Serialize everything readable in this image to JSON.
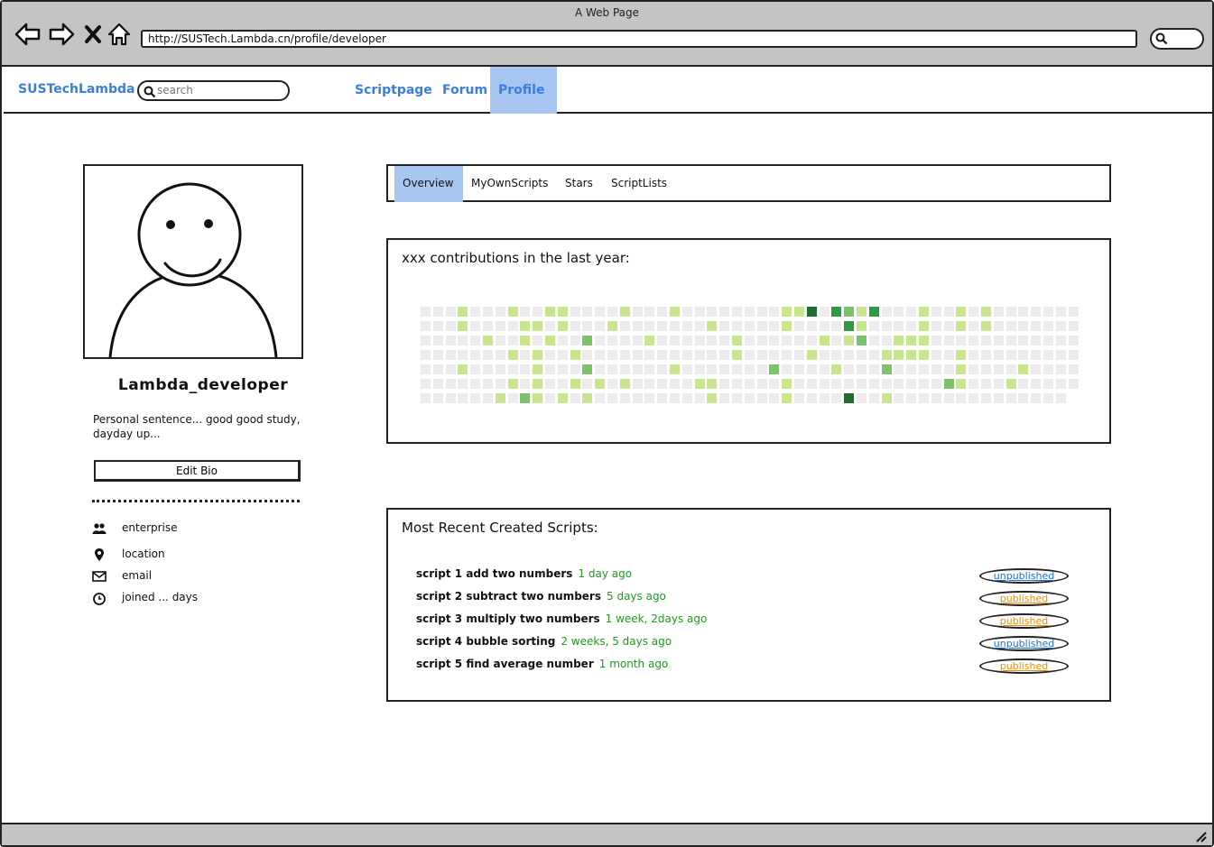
{
  "browser": {
    "window_title": "A Web Page",
    "url": "http://SUSTech.Lambda.cn/profile/developer",
    "icons": [
      "back-arrow-icon",
      "forward-arrow-icon",
      "close-x-icon",
      "home-icon",
      "search-icon"
    ]
  },
  "appbar": {
    "brand": "SUSTechLambda",
    "search_placeholder": "search",
    "nav": [
      {
        "label": "Scriptpage",
        "active": false
      },
      {
        "label": "Forum",
        "active": false
      },
      {
        "label": "Profile",
        "active": true
      }
    ],
    "active_color": "#a7c6f2",
    "link_color": "#3a7fe0"
  },
  "profile": {
    "username": "Lambda_developer",
    "bio": "Personal sentence... good good study, dayday up...",
    "edit_bio_label": "Edit Bio",
    "info": [
      {
        "icon": "users-icon",
        "text": "enterprise"
      },
      {
        "icon": "location-pin-icon",
        "text": "location"
      },
      {
        "icon": "envelope-icon",
        "text": "email"
      },
      {
        "icon": "clock-icon",
        "text": "joined ... days"
      }
    ]
  },
  "tabs": [
    {
      "label": "Overview",
      "active": true
    },
    {
      "label": "MyOwnScripts",
      "active": false
    },
    {
      "label": "Stars",
      "active": false
    },
    {
      "label": "ScriptLists",
      "active": false
    }
  ],
  "contributions": {
    "title": "xxx contributions in the last year:",
    "colors": [
      "#ececec",
      "#c9e58d",
      "#7cc36b",
      "#2f9a46",
      "#1f6e2f"
    ],
    "weeks": 53,
    "active_cells": [
      [
        3,
        0,
        1
      ],
      [
        3,
        1,
        1
      ],
      [
        3,
        4,
        1
      ],
      [
        5,
        2,
        1
      ],
      [
        6,
        6,
        1
      ],
      [
        7,
        0,
        1
      ],
      [
        7,
        3,
        1
      ],
      [
        7,
        5,
        1
      ],
      [
        8,
        1,
        1
      ],
      [
        8,
        2,
        1
      ],
      [
        8,
        6,
        2
      ],
      [
        9,
        1,
        1
      ],
      [
        9,
        3,
        1
      ],
      [
        9,
        4,
        1
      ],
      [
        9,
        5,
        1
      ],
      [
        9,
        6,
        1
      ],
      [
        10,
        0,
        1
      ],
      [
        10,
        2,
        1
      ],
      [
        11,
        0,
        1
      ],
      [
        11,
        1,
        1
      ],
      [
        11,
        6,
        1
      ],
      [
        12,
        3,
        1
      ],
      [
        12,
        5,
        1
      ],
      [
        13,
        2,
        2
      ],
      [
        13,
        4,
        2
      ],
      [
        13,
        6,
        1
      ],
      [
        14,
        5,
        1
      ],
      [
        15,
        1,
        1
      ],
      [
        16,
        0,
        1
      ],
      [
        16,
        5,
        1
      ],
      [
        18,
        2,
        1
      ],
      [
        20,
        0,
        1
      ],
      [
        20,
        4,
        1
      ],
      [
        22,
        5,
        1
      ],
      [
        23,
        1,
        1
      ],
      [
        23,
        5,
        1
      ],
      [
        23,
        6,
        1
      ],
      [
        25,
        2,
        1
      ],
      [
        25,
        3,
        1
      ],
      [
        28,
        4,
        2
      ],
      [
        29,
        0,
        1
      ],
      [
        29,
        1,
        1
      ],
      [
        29,
        5,
        1
      ],
      [
        29,
        6,
        1
      ],
      [
        30,
        0,
        1
      ],
      [
        31,
        0,
        4
      ],
      [
        31,
        3,
        1
      ],
      [
        32,
        2,
        1
      ],
      [
        33,
        0,
        3
      ],
      [
        33,
        4,
        1
      ],
      [
        34,
        0,
        2
      ],
      [
        34,
        1,
        3
      ],
      [
        34,
        2,
        1
      ],
      [
        34,
        6,
        4
      ],
      [
        35,
        0,
        1
      ],
      [
        35,
        1,
        1
      ],
      [
        35,
        2,
        2
      ],
      [
        36,
        0,
        3
      ],
      [
        37,
        3,
        1
      ],
      [
        37,
        4,
        2
      ],
      [
        37,
        6,
        1
      ],
      [
        38,
        2,
        1
      ],
      [
        38,
        3,
        1
      ],
      [
        39,
        2,
        1
      ],
      [
        39,
        3,
        1
      ],
      [
        40,
        0,
        1
      ],
      [
        40,
        1,
        1
      ],
      [
        40,
        2,
        1
      ],
      [
        40,
        3,
        1
      ],
      [
        42,
        5,
        2
      ],
      [
        43,
        0,
        1
      ],
      [
        43,
        1,
        1
      ],
      [
        43,
        3,
        1
      ],
      [
        43,
        4,
        1
      ],
      [
        43,
        5,
        1
      ],
      [
        45,
        0,
        1
      ],
      [
        45,
        1,
        1
      ],
      [
        47,
        5,
        1
      ],
      [
        48,
        4,
        1
      ]
    ]
  },
  "recent": {
    "title": "Most Recent Created Scripts:",
    "scripts": [
      {
        "name": "script 1 add two numbers",
        "ago": "1 day ago",
        "status": "unpublished",
        "status_color": "#1e6fd9"
      },
      {
        "name": "script 2 subtract two numbers",
        "ago": "5 days ago",
        "status": "published",
        "status_color": "#f28c00"
      },
      {
        "name": "script 3 multiply two numbers",
        "ago": "1 week, 2days ago",
        "status": "published",
        "status_color": "#f28c00"
      },
      {
        "name": "script 4 bubble sorting",
        "ago": "2 weeks, 5 days ago",
        "status": "unpublished",
        "status_color": "#1e6fd9"
      },
      {
        "name": "script 5 find average number",
        "ago": "1 month ago",
        "status": "published",
        "status_color": "#f28c00"
      }
    ]
  }
}
